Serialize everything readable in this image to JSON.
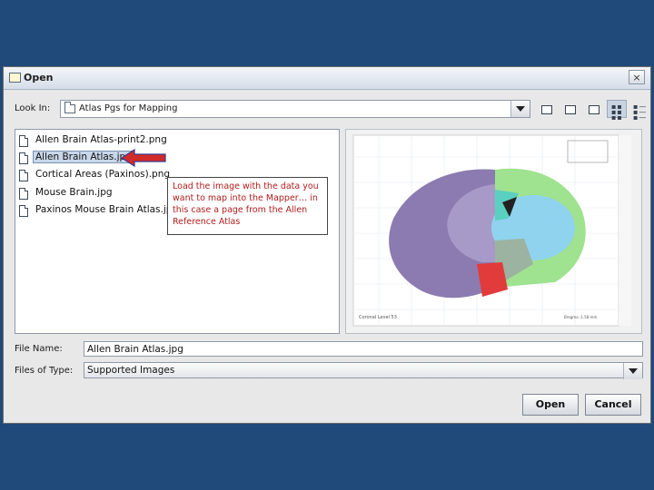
{
  "dialog": {
    "title": "Open",
    "close_glyph": "×"
  },
  "look_in": {
    "label": "Look In:",
    "value": "Atlas Pgs for Mapping"
  },
  "toolbar": [
    {
      "name": "up-one-level-icon"
    },
    {
      "name": "home-icon"
    },
    {
      "name": "new-folder-icon"
    },
    {
      "name": "list-view-icon"
    },
    {
      "name": "details-view-icon"
    }
  ],
  "files": [
    {
      "name": "Allen Brain Atlas-print2.png",
      "selected": false
    },
    {
      "name": "Allen Brain Atlas.jpg",
      "selected": true
    },
    {
      "name": "Cortical Areas (Paxinos).png",
      "selected": false
    },
    {
      "name": "Mouse Brain.jpg",
      "selected": false
    },
    {
      "name": "Paxinos Mouse Brain Atlas.jpg",
      "selected": false
    }
  ],
  "callout": {
    "text": "Load the image with the data you want to map into the Mapper… in this case a page from the Allen Reference Atlas"
  },
  "preview": {
    "caption_left": "Coronal Level 53",
    "caption_right": "Bregma -1.58 mm",
    "colors": {
      "nissl": "#8c7bb0",
      "green": "#9fe28f",
      "blue": "#8fd3ee",
      "red": "#e23b3b",
      "teal": "#5ad0c0"
    }
  },
  "file_name": {
    "label": "File Name:",
    "value": "Allen Brain Atlas.jpg"
  },
  "file_type": {
    "label": "Files of Type:",
    "value": "Supported Images"
  },
  "buttons": {
    "open": "Open",
    "cancel": "Cancel"
  }
}
